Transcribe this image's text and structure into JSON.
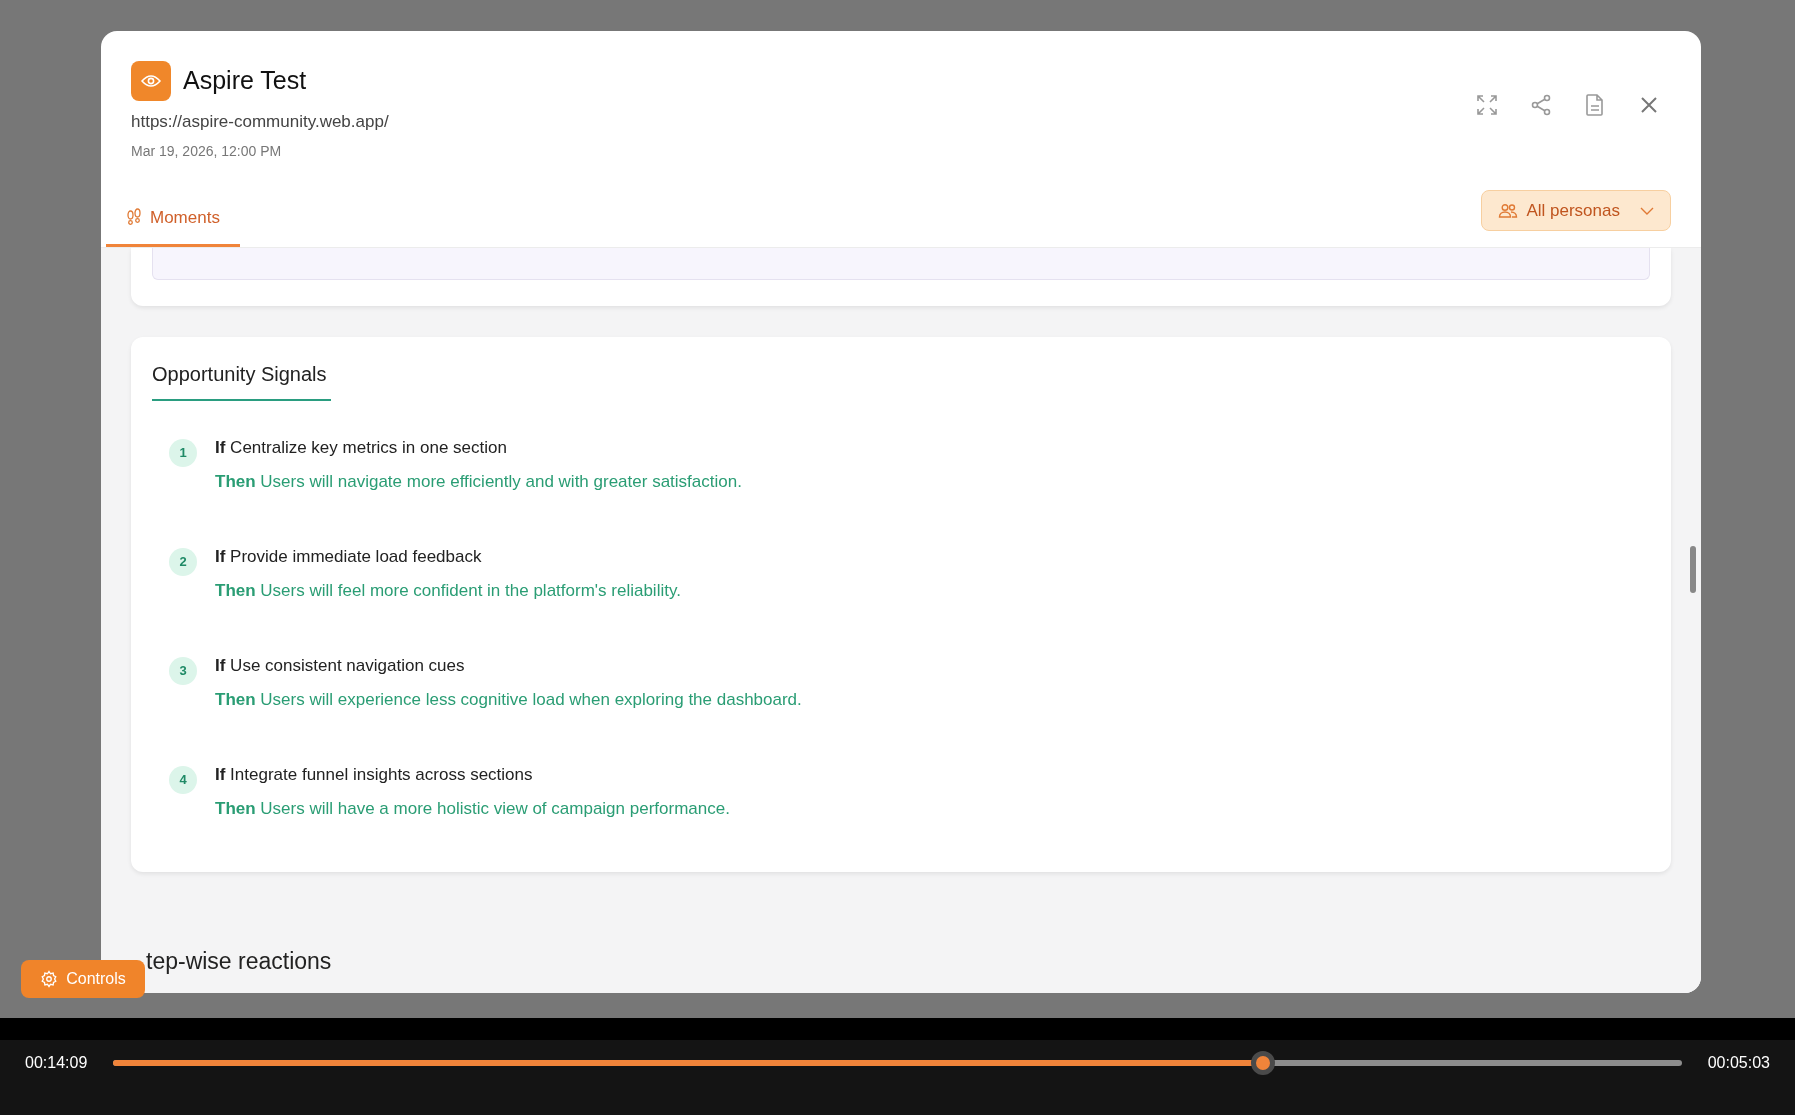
{
  "modal": {
    "title": "Aspire Test",
    "url": "https://aspire-community.web.app/",
    "date": "Mar 19, 2026, 12:00 PM"
  },
  "tabs": [
    {
      "label": "Moments",
      "selected": true
    }
  ],
  "persona_filter": {
    "label": "All personas"
  },
  "opportunity_signals": {
    "title": "Opportunity Signals",
    "items": [
      {
        "number": "1",
        "if_text": "**If** Centralize key metrics in one section",
        "then_text": "**Then** Users will navigate more efficiently and with greater satisfaction."
      },
      {
        "number": "2",
        "if_text": "**If** Provide immediate load feedback",
        "then_text": "**Then** Users will feel more confident in the platform's reliability."
      },
      {
        "number": "3",
        "if_text": "**If** Use consistent navigation cues",
        "then_text": "**Then** Users will experience less cognitive load when exploring the dashboard."
      },
      {
        "number": "4",
        "if_text": "**If** Integrate funnel insights across sections",
        "then_text": "**Then** Users will have a more holistic view of campaign performance."
      }
    ]
  },
  "next_section_heading": "tep-wise reactions",
  "controls_button": {
    "label": "Controls"
  },
  "player": {
    "elapsed": "00:14:09",
    "remaining": "00:05:03",
    "level": 0.733
  }
}
